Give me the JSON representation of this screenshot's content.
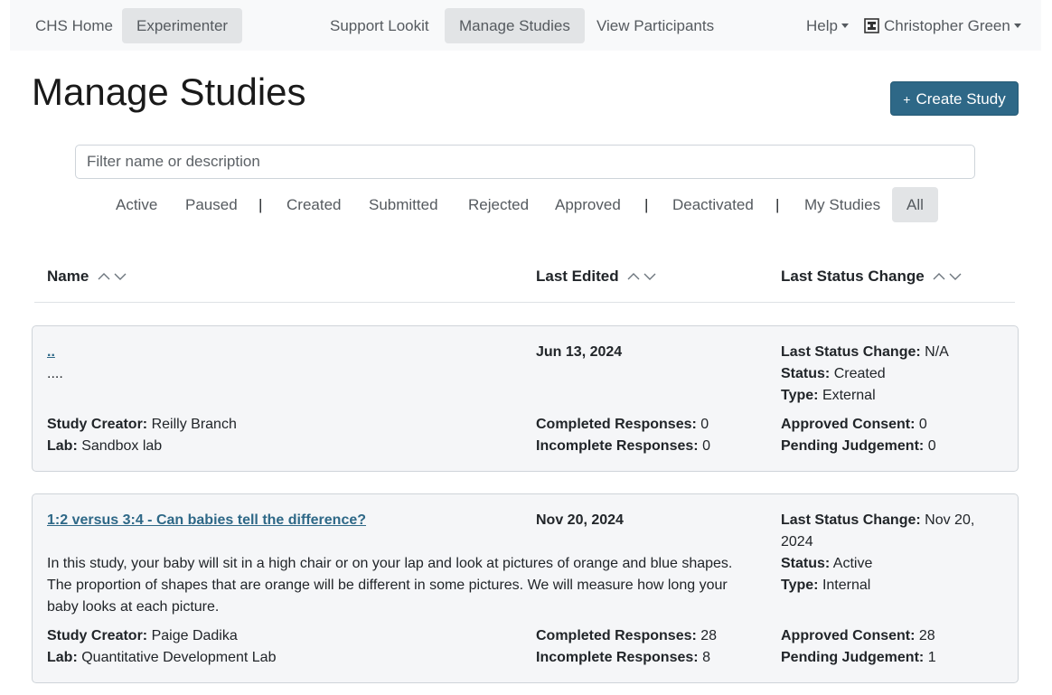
{
  "navbar": {
    "home": "CHS Home",
    "experimenter": "Experimenter",
    "support": "Support Lookit",
    "manage": "Manage Studies",
    "participants": "View Participants",
    "help": "Help",
    "user": "Christopher Green"
  },
  "page": {
    "title": "Manage Studies",
    "create_label": "Create Study",
    "filter_placeholder": "Filter name or description"
  },
  "tabs": [
    "Active",
    "Paused",
    "Created",
    "Submitted",
    "Rejected",
    "Approved",
    "Deactivated",
    "My Studies",
    "All"
  ],
  "separator": "|",
  "columns": {
    "name": "Name",
    "last_edited": "Last Edited",
    "last_status": "Last Status Change"
  },
  "labels": {
    "last_status": "Last Status Change:",
    "status": "Status:",
    "type": "Type:",
    "creator": "Study Creator:",
    "lab": "Lab:",
    "completed": "Completed Responses:",
    "incomplete": "Incomplete Responses:",
    "approved": "Approved Consent:",
    "pending": "Pending Judgement:"
  },
  "studies": [
    {
      "name": "..",
      "description": "....",
      "last_edited": "Jun 13, 2024",
      "last_status_change": "N/A",
      "status": "Created",
      "type": "External",
      "creator": "Reilly Branch",
      "lab": "Sandbox lab",
      "completed": "0",
      "incomplete": "0",
      "approved_consent": "0",
      "pending_judgement": "0"
    },
    {
      "name": "1:2 versus 3:4 - Can babies tell the difference?",
      "description": "In this study, your baby will sit in a high chair or on your lap and look at pictures of orange and blue shapes. The proportion of shapes that are orange will be different in some pictures. We will measure how long your baby looks at each picture.",
      "last_edited": "Nov 20, 2024",
      "last_status_change_line1": "Nov 20,",
      "last_status_change_line2": "2024",
      "status": "Active",
      "type": "Internal",
      "creator": "Paige Dadika",
      "lab": "Quantitative Development Lab",
      "completed": "28",
      "incomplete": "8",
      "approved_consent": "28",
      "pending_judgement": "1"
    }
  ]
}
